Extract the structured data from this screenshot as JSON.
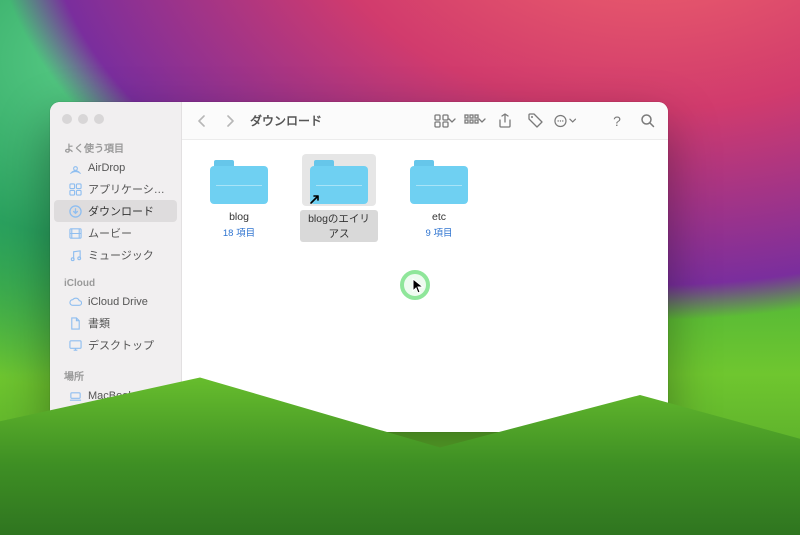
{
  "sidebar": {
    "sections": [
      {
        "header": "よく使う項目",
        "items": [
          {
            "icon": "airdrop",
            "label": "AirDrop"
          },
          {
            "icon": "apps",
            "label": "アプリケーシ…"
          },
          {
            "icon": "download",
            "label": "ダウンロード",
            "selected": true
          },
          {
            "icon": "movie",
            "label": "ムービー"
          },
          {
            "icon": "music",
            "label": "ミュージック"
          }
        ]
      },
      {
        "header": "iCloud",
        "items": [
          {
            "icon": "cloud",
            "label": "iCloud Drive"
          },
          {
            "icon": "doc",
            "label": "書類"
          },
          {
            "icon": "desktop",
            "label": "デスクトップ"
          }
        ]
      },
      {
        "header": "場所",
        "items": [
          {
            "icon": "laptop",
            "label": "MacBook Air"
          }
        ]
      }
    ]
  },
  "toolbar": {
    "title": "ダウンロード"
  },
  "folders": [
    {
      "name": "blog",
      "count": "18 項目",
      "alias": false,
      "selected": false
    },
    {
      "name": "blogのエイリアス",
      "count": "",
      "alias": true,
      "selected": true
    },
    {
      "name": "etc",
      "count": "9 項目",
      "alias": false,
      "selected": false
    }
  ]
}
